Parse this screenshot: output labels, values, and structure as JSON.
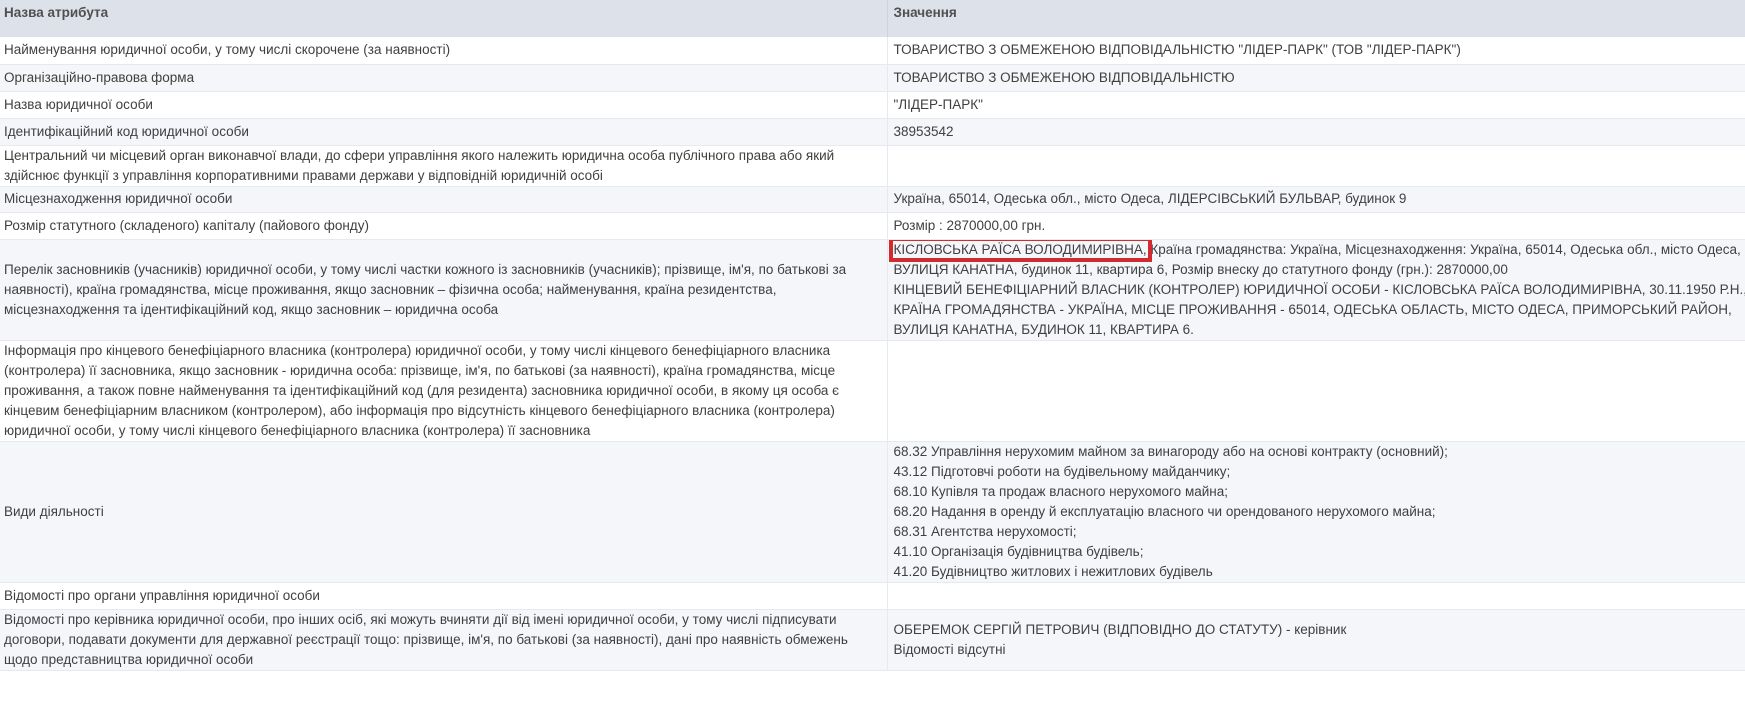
{
  "header": {
    "col_attr": "Назва атрибута",
    "col_value": "Значення"
  },
  "rows": [
    {
      "attr": [
        "Найменування юридичної особи, у тому числі скорочене (за наявності)"
      ],
      "value": [
        "ТОВАРИСТВО З ОБМЕЖЕНОЮ ВІДПОВІДАЛЬНІСТЮ \"ЛІДЕР-ПАРК\" (ТОВ \"ЛІДЕР-ПАРК\")"
      ]
    },
    {
      "attr": [
        "Організаційно-правова форма"
      ],
      "value": [
        "ТОВАРИСТВО З ОБМЕЖЕНОЮ ВІДПОВІДАЛЬНІСТЮ"
      ]
    },
    {
      "attr": [
        "Назва юридичної особи"
      ],
      "value": [
        "\"ЛІДЕР-ПАРК\""
      ]
    },
    {
      "attr": [
        "Ідентифікаційний код юридичної особи"
      ],
      "value": [
        "38953542"
      ]
    },
    {
      "attr": [
        "Центральний чи місцевий орган виконавчої влади, до сфери управління якого належить юридична особа публічного права або який",
        "здійснює функції з управління корпоративними правами держави у відповідній юридичній особі"
      ],
      "value": []
    },
    {
      "attr": [
        "Місцезнаходження юридичної особи"
      ],
      "value": [
        "Україна, 65014, Одеська обл., місто Одеса, ЛІДЕРСІВСЬКИЙ БУЛЬВАР, будинок 9"
      ]
    },
    {
      "attr": [
        "Розмір статутного (складеного) капіталу (пайового фонду)"
      ],
      "value": [
        "Розмір : 2870000,00 грн."
      ]
    },
    {
      "attr": [
        "Перелік засновників (учасників) юридичної особи, у тому числі частки кожного із засновників (учасників); прізвище, ім'я, по батькові за",
        "наявності), країна громадянства, місце проживання, якщо засновник – фізична особа; найменування, країна резидентства,",
        "місцезнаходження та ідентифікаційний код, якщо засновник – юридична особа"
      ],
      "value_highlight": "КІСЛОВСЬКА РАЇСА ВОЛОДИМИРІВНА,",
      "value_first_rest": " Країна громадянства: Україна, Місцезнаходження: Україна, 65014, Одеська обл., місто Одеса,",
      "value": [
        "ВУЛИЦЯ КАНАТНА, будинок 11, квартира 6, Розмір внеску до статутного фонду (грн.): 2870000,00",
        "КІНЦЕВИЙ БЕНЕФІЦІАРНИЙ ВЛАСНИК (КОНТРОЛЕР) ЮРИДИЧНОЇ ОСОБИ - КІСЛОВСЬКА РАЇСА ВОЛОДИМИРІВНА, 30.11.1950 Р.Н.,",
        "КРАЇНА ГРОМАДЯНСТВА - УКРАЇНА, МІСЦЕ ПРОЖИВАННЯ - 65014, ОДЕСЬКА ОБЛАСТЬ, МІСТО ОДЕСА, ПРИМОРСЬКИЙ РАЙОН,",
        "ВУЛИЦЯ КАНАТНА, БУДИНОК 11, КВАРТИРА 6."
      ]
    },
    {
      "attr": [
        "Інформація про кінцевого бенефіціарного власника (контролера) юридичної особи, у тому числі кінцевого бенефіціарного власника",
        "(контролера) її засновника, якщо засновник - юридична особа: прізвище, ім'я, по батькові (за наявності), країна громадянства, місце",
        "проживання, а також повне найменування та ідентифікаційний код (для резидента) засновника юридичної особи, в якому ця особа є",
        "кінцевим бенефіціарним власником (контролером), або інформація про відсутність кінцевого бенефіціарного власника (контролера)",
        "юридичної особи, у тому числі кінцевого бенефіціарного власника (контролера) її засновника"
      ],
      "value": []
    },
    {
      "attr": [
        "Види діяльності"
      ],
      "value": [
        "68.32 Управління нерухомим майном за винагороду або на основі контракту (основний);",
        "43.12 Підготовчі роботи на будівельному майданчику;",
        "68.10 Купівля та продаж власного нерухомого майна;",
        "68.20 Надання в оренду й експлуатацію власного чи орендованого нерухомого майна;",
        "68.31 Агентства нерухомості;",
        "41.10 Організація будівництва будівель;",
        "41.20 Будівництво житлових і нежитлових будівель"
      ]
    },
    {
      "attr": [
        "Відомості про органи управління юридичної особи"
      ],
      "value": []
    },
    {
      "attr": [
        "Відомості про керівника юридичної особи, про інших осіб, які можуть вчиняти дії від імені юридичної особи, у тому числі підписувати",
        "договори, подавати документи для державної реєстрації тощо: прізвище, ім'я, по батькові (за наявності), дані про наявність обмежень",
        "щодо представництва юридичної особи"
      ],
      "value": [
        "ОБЕРЕМОК СЕРГІЙ ПЕТРОВИЧ (ВІДПОВІДНО ДО СТАТУТУ) - керівник",
        "Відомості відсутні"
      ]
    }
  ]
}
